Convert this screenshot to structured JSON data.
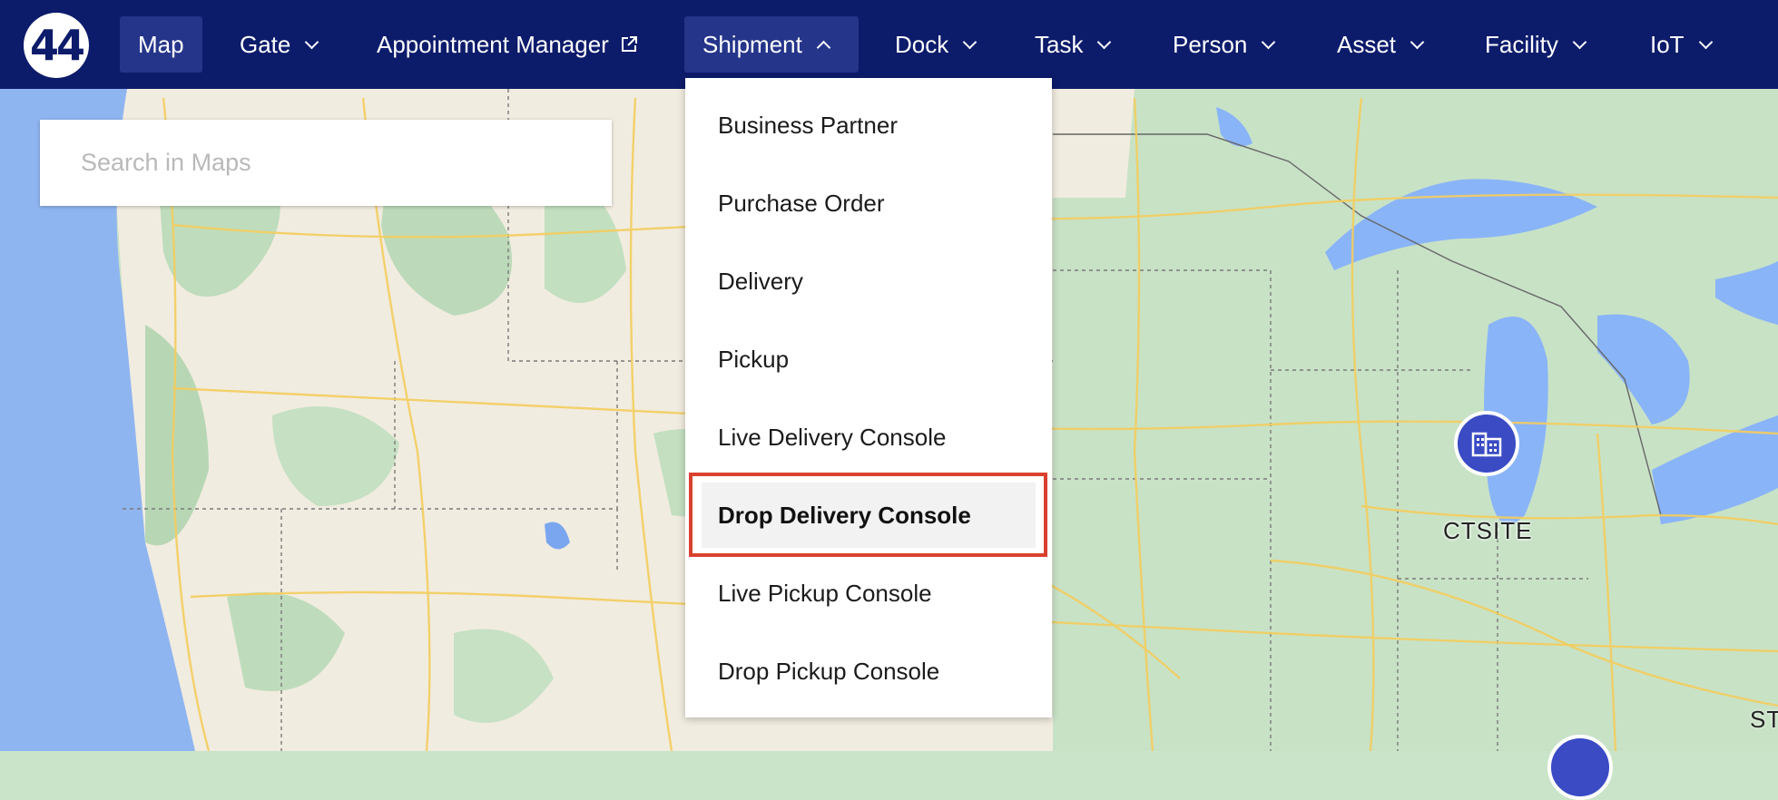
{
  "brand": {
    "logo_text": "44"
  },
  "nav": {
    "items": [
      {
        "label": "Map",
        "active": true,
        "has_chevron": false
      },
      {
        "label": "Gate",
        "has_chevron": true
      },
      {
        "label": "Appointment Manager",
        "external_icon": "external-link-icon"
      },
      {
        "label": "Shipment",
        "active": true,
        "expanded": true
      },
      {
        "label": "Dock",
        "has_chevron": true
      },
      {
        "label": "Task",
        "has_chevron": true
      },
      {
        "label": "Person",
        "has_chevron": true
      },
      {
        "label": "Asset",
        "has_chevron": true
      },
      {
        "label": "Facility",
        "has_chevron": true
      },
      {
        "label": "IoT",
        "has_chevron": true
      }
    ]
  },
  "search": {
    "placeholder": "Search in Maps",
    "value": ""
  },
  "shipment_menu": {
    "items": [
      {
        "label": "Business Partner"
      },
      {
        "label": "Purchase Order"
      },
      {
        "label": "Delivery"
      },
      {
        "label": "Pickup"
      },
      {
        "label": "Live Delivery Console"
      },
      {
        "label": "Drop Delivery Console",
        "highlighted": true
      },
      {
        "label": "Live Pickup Console"
      },
      {
        "label": "Drop Pickup Console"
      }
    ]
  },
  "map": {
    "markers": [
      {
        "label": "CTSITE",
        "icon": "building-icon"
      },
      {
        "label": "ST"
      }
    ]
  },
  "colors": {
    "nav_bg": "#0d1b6b",
    "nav_active": "#25358a",
    "marker": "#3a4bc4",
    "highlight_border": "#d9412e",
    "water": "#8ab4f8",
    "land_green": "#c9e4c9",
    "land_tan": "#f3ede0",
    "road": "#f6d26b"
  }
}
